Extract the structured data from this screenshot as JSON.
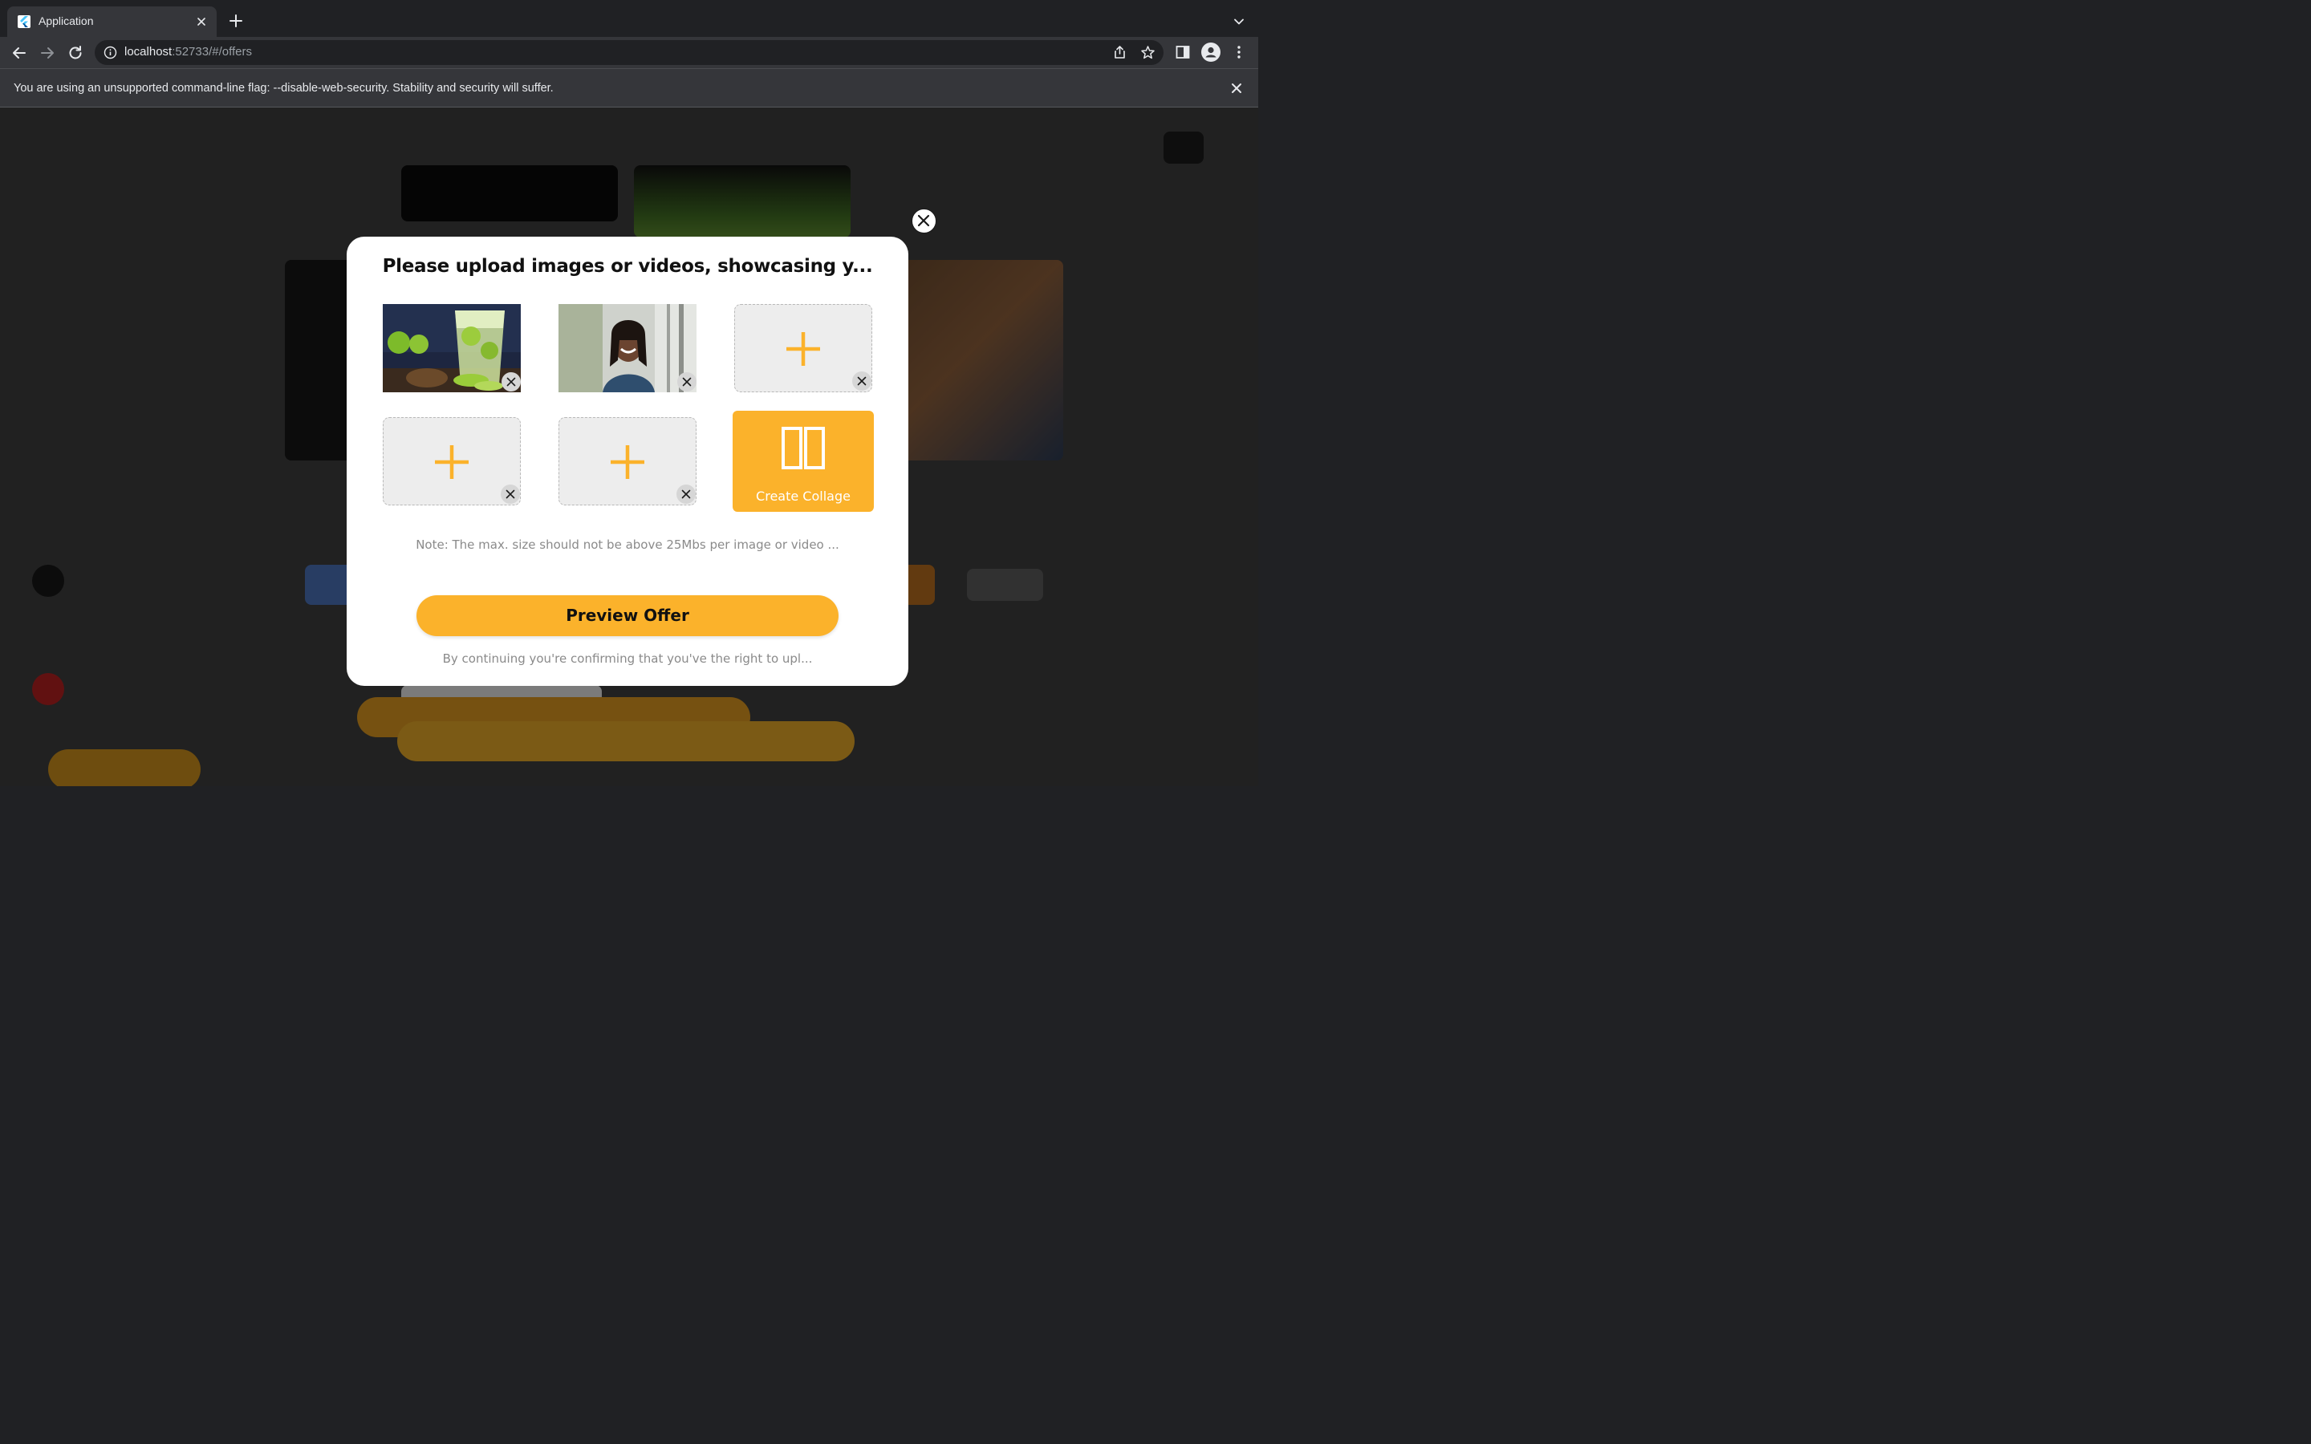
{
  "browser": {
    "tab_title": "Application",
    "url_host": "localhost",
    "url_rest": ":52733/#/offers",
    "infobar_text": "You are using an unsupported command-line flag: --disable-web-security. Stability and security will suffer."
  },
  "modal": {
    "title": "Please upload images or videos, showcasing y...",
    "slots": [
      {
        "state": "filled",
        "content": "drink-photo"
      },
      {
        "state": "filled",
        "content": "person-photo"
      },
      {
        "state": "empty",
        "content": "add-media"
      },
      {
        "state": "empty",
        "content": "add-media"
      },
      {
        "state": "empty",
        "content": "add-media"
      }
    ],
    "collage_label": "Create Collage",
    "note": "Note: The max. size should not be above 25Mbs per image or video ...",
    "preview_button": "Preview Offer",
    "footer_note": "By continuing you're confirming that you've the right to upl..."
  },
  "colors": {
    "accent": "#fbb22b",
    "modal_bg": "#ffffff",
    "chrome_dark": "#202124",
    "chrome_mid": "#35363a"
  },
  "icons": [
    "flutter-icon",
    "close-icon",
    "plus-icon",
    "back-arrow-icon",
    "forward-arrow-icon",
    "reload-icon",
    "info-icon",
    "share-icon",
    "star-icon",
    "sidebar-icon",
    "profile-icon",
    "more-vert-icon",
    "chevron-down-icon",
    "collage-icon"
  ]
}
